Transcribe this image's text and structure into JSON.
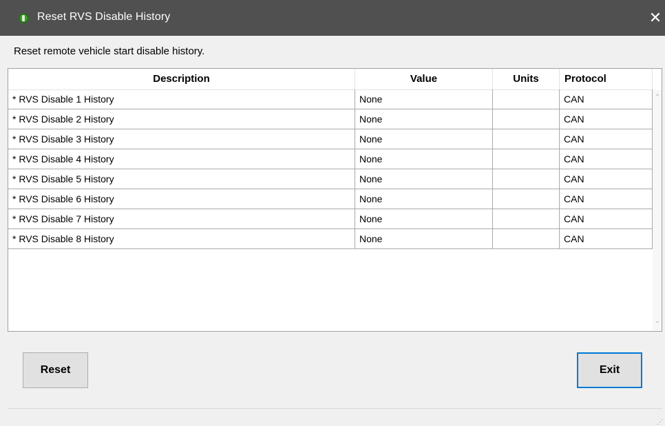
{
  "window": {
    "title": "Reset RVS Disable History",
    "close_glyph": "✕",
    "icon": "app-logo-icon"
  },
  "subtitle": "Reset remote vehicle start disable history.",
  "table": {
    "columns": [
      "Description",
      "Value",
      "Units",
      "Protocol"
    ],
    "rows": [
      {
        "description": "* RVS Disable 1 History",
        "value": "None",
        "units": "",
        "protocol": "CAN"
      },
      {
        "description": "* RVS Disable 2 History",
        "value": "None",
        "units": "",
        "protocol": "CAN"
      },
      {
        "description": "* RVS Disable 3 History",
        "value": "None",
        "units": "",
        "protocol": "CAN"
      },
      {
        "description": "* RVS Disable 4 History",
        "value": "None",
        "units": "",
        "protocol": "CAN"
      },
      {
        "description": "* RVS Disable 5 History",
        "value": "None",
        "units": "",
        "protocol": "CAN"
      },
      {
        "description": "* RVS Disable 6 History",
        "value": "None",
        "units": "",
        "protocol": "CAN"
      },
      {
        "description": "* RVS Disable 7 History",
        "value": "None",
        "units": "",
        "protocol": "CAN"
      },
      {
        "description": "* RVS Disable 8 History",
        "value": "None",
        "units": "",
        "protocol": "CAN"
      }
    ]
  },
  "scrollbar": {
    "up_glyph": "⌃",
    "down_glyph": "⌄"
  },
  "buttons": {
    "reset_label": "Reset",
    "exit_label": "Exit"
  },
  "colors": {
    "titlebar": "#505050",
    "exit_focus_border": "#0078d7",
    "app_icon": "#3c9a2e"
  }
}
